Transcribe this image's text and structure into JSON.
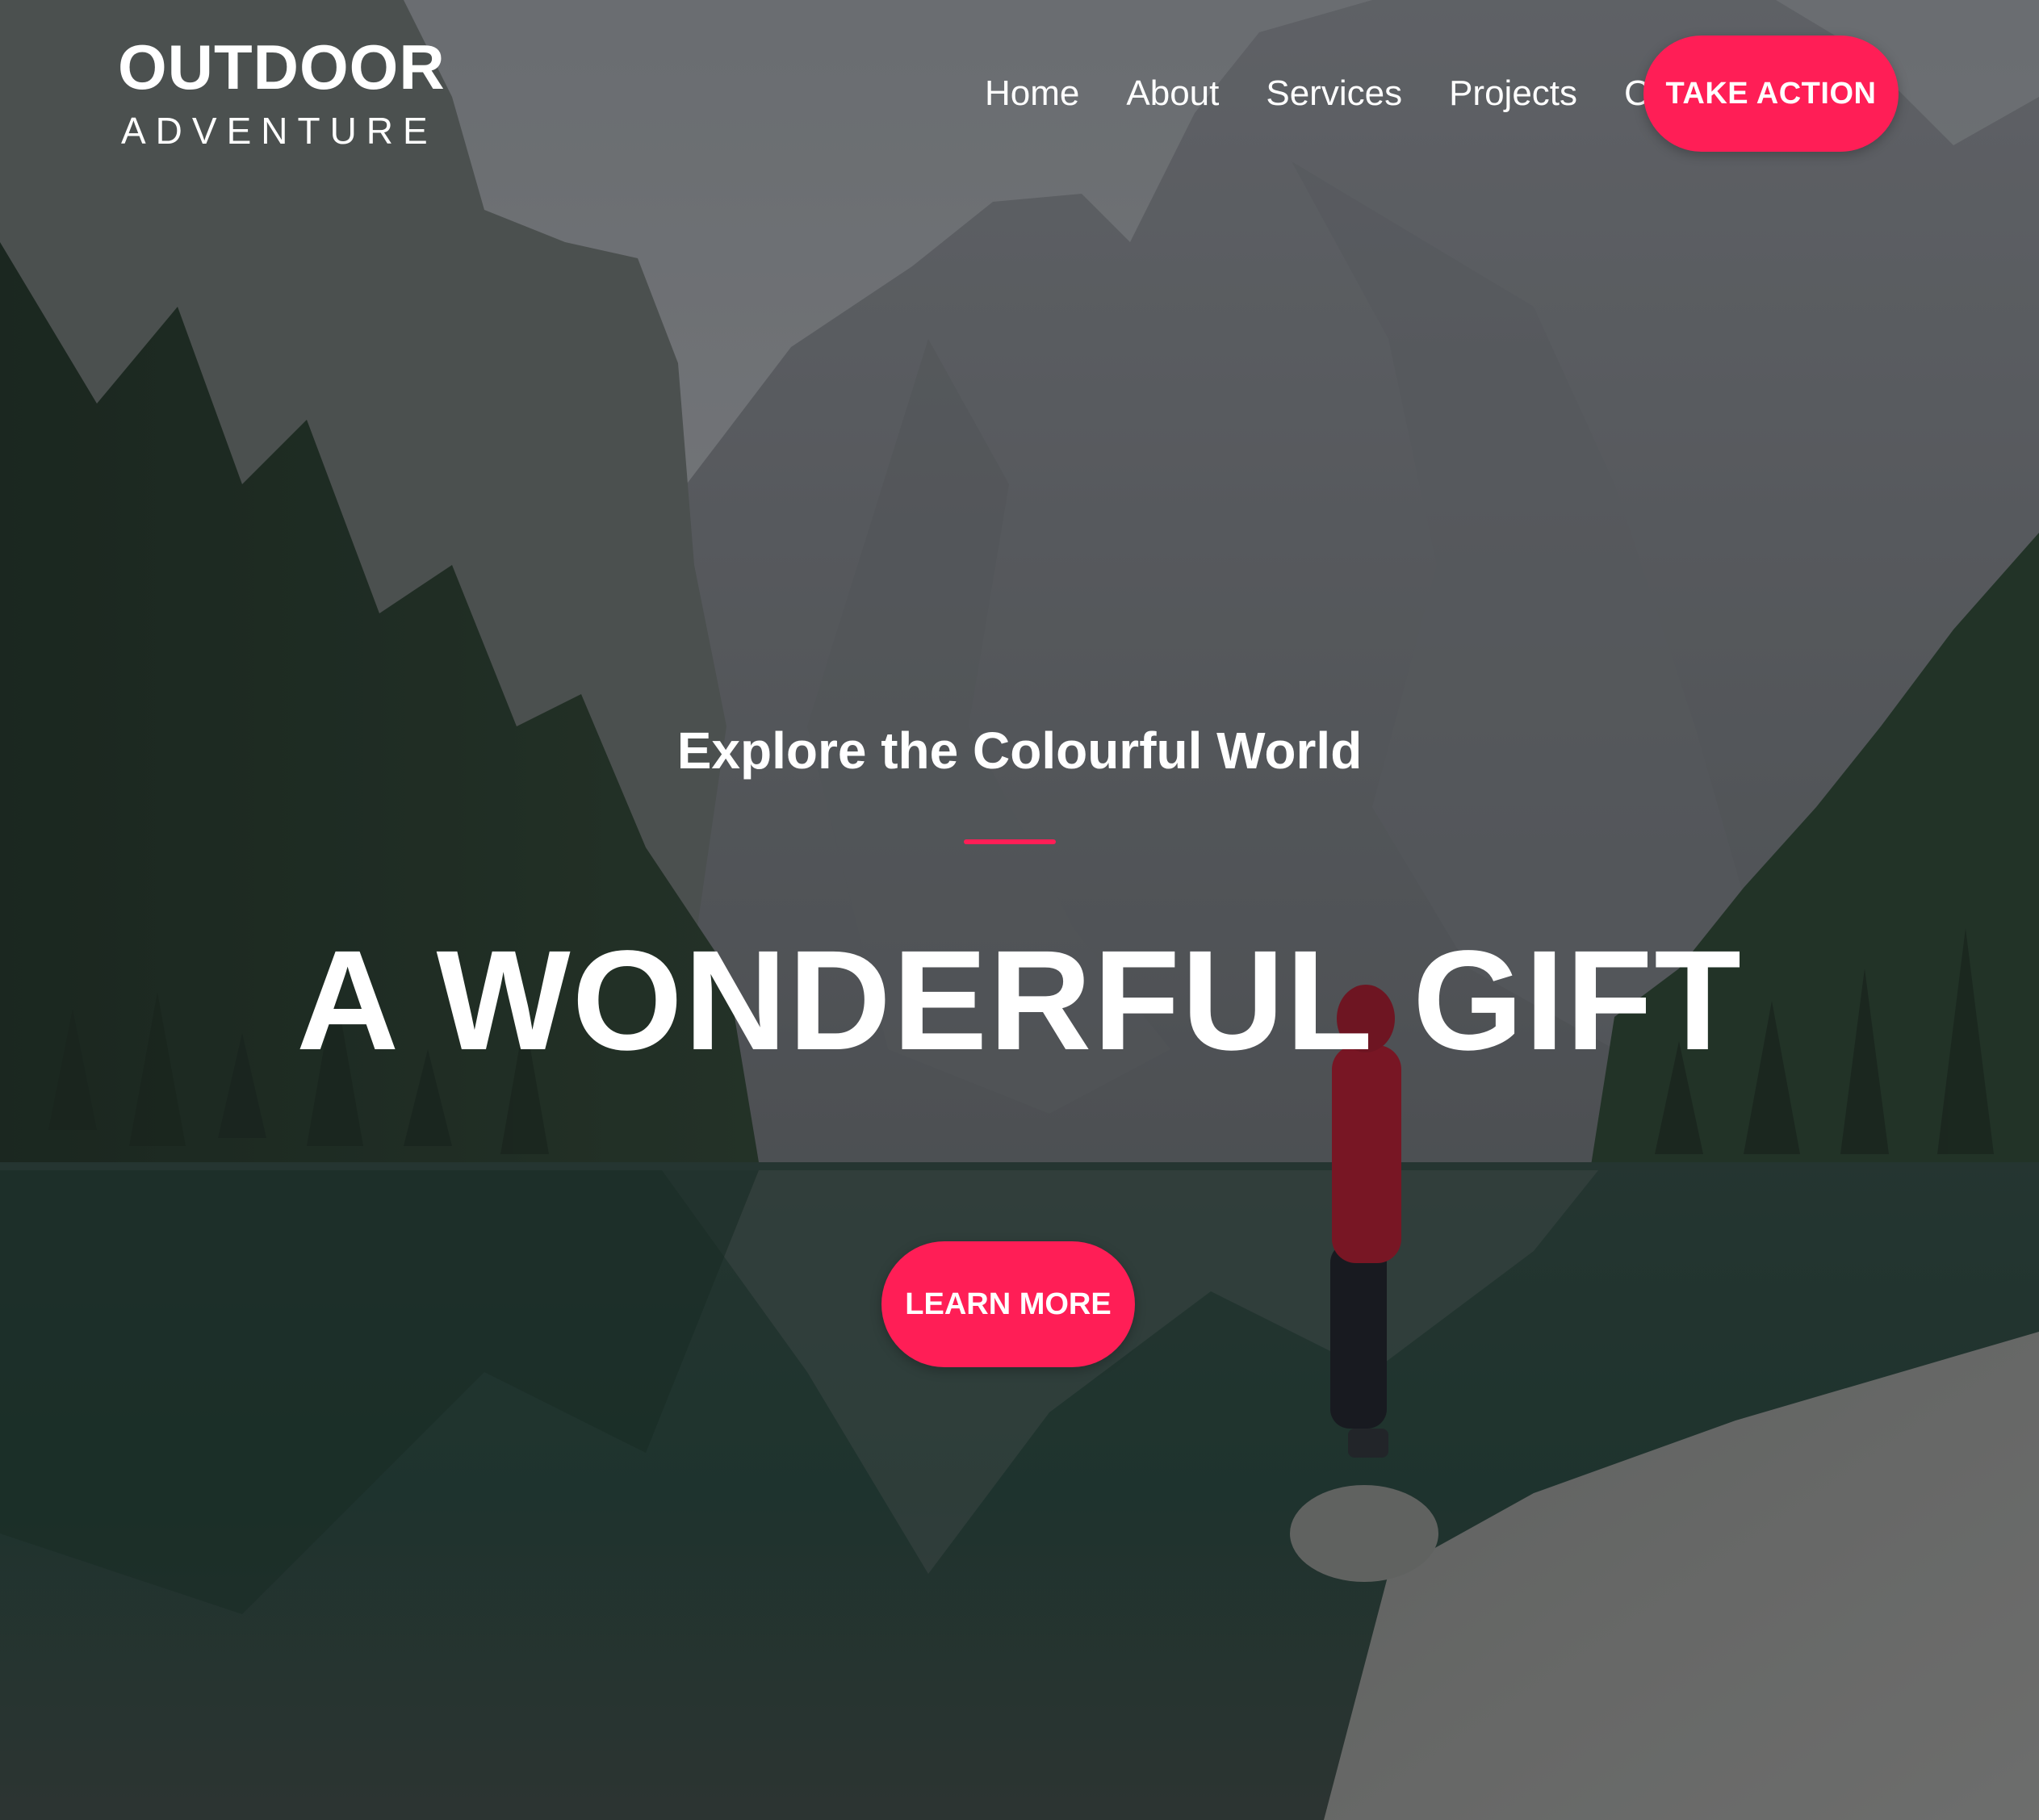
{
  "header": {
    "logo_main": "OUTDOOR",
    "logo_sub": "ADVENTURE",
    "nav": [
      {
        "label": "Home"
      },
      {
        "label": "About"
      },
      {
        "label": "Services"
      },
      {
        "label": "Projects"
      },
      {
        "label": "Contact"
      }
    ],
    "cta_label": "TAKE ACTION"
  },
  "hero": {
    "subtitle": "Explore the Colourful World",
    "title": "A WONDERFUL GIFT",
    "button_label": "LEARN MORE"
  },
  "colors": {
    "accent": "#ff1e56",
    "text": "#ffffff"
  }
}
